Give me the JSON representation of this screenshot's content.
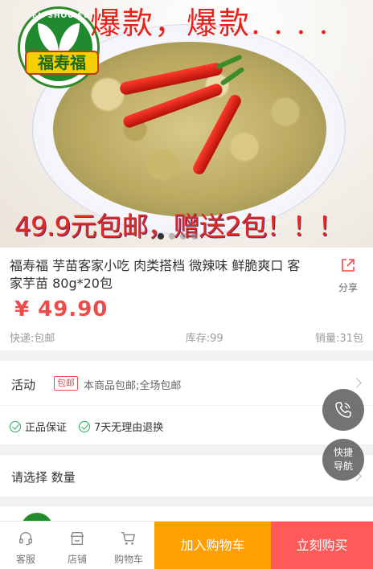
{
  "banner": {
    "promo_top": "爆款，爆款. . . .",
    "promo_bottom": "49.9元包邮，赠送2包！！！",
    "logo_text": "福寿福",
    "logo_arc": "FU SHOU FU",
    "slide_count": 4,
    "active_slide": 1
  },
  "product": {
    "title": "福寿福 芋苗客家小吃 肉类搭档 微辣味 鲜脆爽口 客家芋苗 80g*20包",
    "share_label": "分享",
    "price": "¥ 49.90",
    "shipping": "快递:包邮",
    "stock": "库存:99",
    "sales": "销量:31包"
  },
  "activity": {
    "label": "活动",
    "tag": "包邮",
    "desc": "本商品包邮;全场包邮"
  },
  "guarantees": [
    "正品保证",
    "7天无理由退换"
  ],
  "spec": {
    "label": "请选择 数量"
  },
  "floating": {
    "nav_label_1": "快捷",
    "nav_label_2": "导航"
  },
  "bottom_bar": {
    "service": "客服",
    "shop": "店铺",
    "cart": "购物车",
    "add_to_cart": "加入购物车",
    "buy_now": "立刻购买"
  },
  "colors": {
    "price": "#f04b4b",
    "cart_button": "#ff9f00",
    "buy_button": "#ff5a5a"
  }
}
